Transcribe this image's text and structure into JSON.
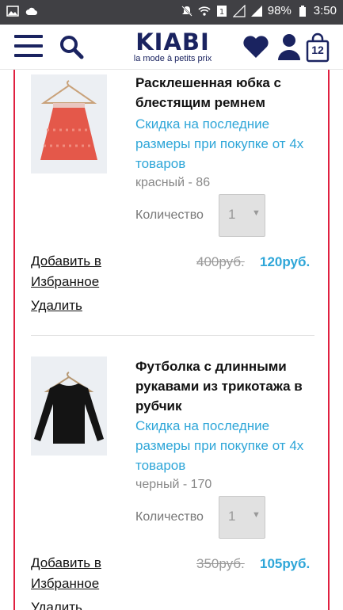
{
  "status_bar": {
    "battery": "98%",
    "time": "3:50"
  },
  "header": {
    "brand": "KIABI",
    "tagline": "la mode à petits prix",
    "cart_count": "12"
  },
  "items": [
    {
      "title": "Расклешенная юбка с блестящим ремнем",
      "promo": "Скидка на последние размеры при покупке от 4х товаров",
      "variant": "красный - 86",
      "qty_label": "Количество",
      "qty_value": "1",
      "fav_label": "Добавить в Избранное",
      "remove_label": "Удалить",
      "old_price": "400руб.",
      "new_price": "120руб."
    },
    {
      "title": "Футболка с длинными рукавами из трикотажа в рубчик",
      "promo": "Скидка на последние размеры при покупке от 4х товаров",
      "variant": "черный - 170",
      "qty_label": "Количество",
      "qty_value": "1",
      "fav_label": "Добавить в Избранное",
      "remove_label": "Удалить",
      "old_price": "350руб.",
      "new_price": "105руб."
    }
  ],
  "colors": {
    "brand": "#1a2360",
    "promo": "#2ea6d8",
    "border": "#e02040"
  }
}
